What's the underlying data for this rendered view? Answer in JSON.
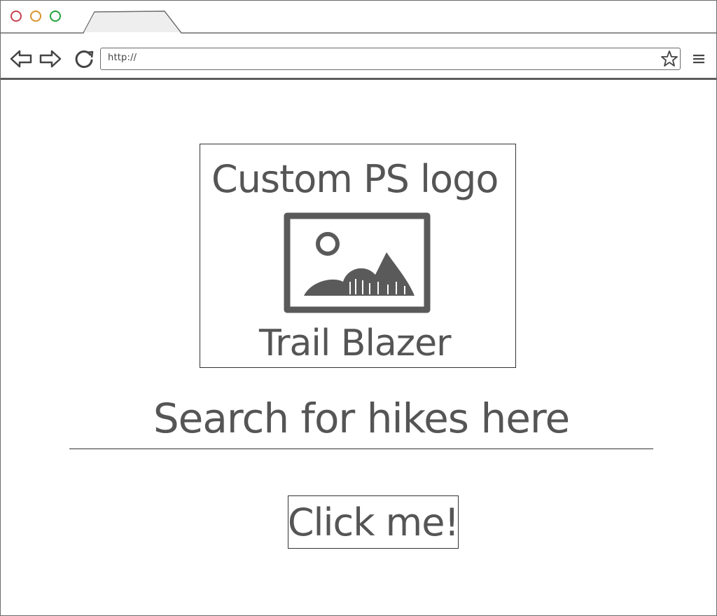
{
  "browser": {
    "url": "http://",
    "controls": {
      "back_icon": "arrow-left-icon",
      "forward_icon": "arrow-right-icon",
      "reload_icon": "reload-icon",
      "bookmark_icon": "star-icon",
      "menu_icon": "hamburger-menu-icon"
    },
    "window_buttons": [
      "close",
      "minimize",
      "maximize"
    ],
    "colors": {
      "close": "#c8414f",
      "minimize": "#d9932b",
      "maximize": "#23a23a"
    }
  },
  "logo": {
    "title": "Custom PS logo",
    "subtitle": "Trail Blazer",
    "image_icon": "image-placeholder-icon"
  },
  "search": {
    "placeholder": "Search for hikes here"
  },
  "button": {
    "label": "Click me!"
  }
}
